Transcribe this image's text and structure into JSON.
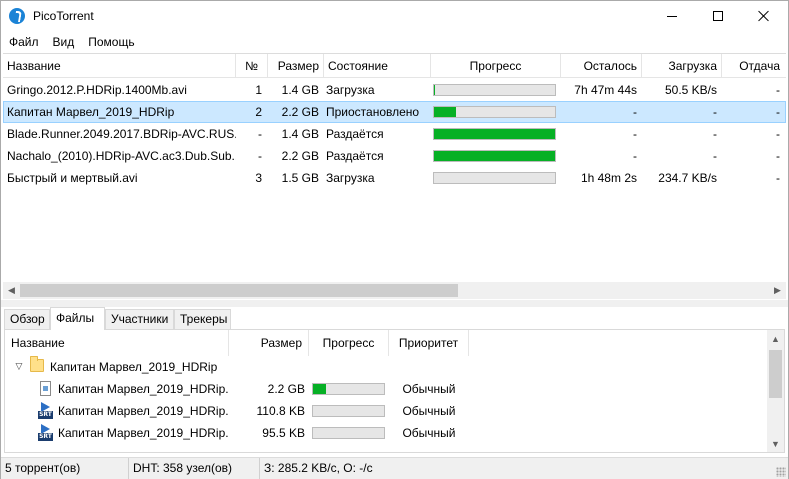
{
  "window": {
    "title": "PicoTorrent"
  },
  "menu": [
    "Файл",
    "Вид",
    "Помощь"
  ],
  "torrents": {
    "columns": [
      "Название",
      "№",
      "Размер",
      "Состояние",
      "Прогресс",
      "Осталось",
      "Загрузка",
      "Отдача"
    ],
    "rows": [
      {
        "name": "Gringo.2012.P.HDRip.1400Mb.avi",
        "num": "1",
        "size": "1.4 GB",
        "state": "Загрузка",
        "progress": 0.01,
        "remaining": "7h 47m 44s",
        "down": "50.5 KB/s",
        "up": "-"
      },
      {
        "name": "Капитан Марвел_2019_HDRip",
        "num": "2",
        "size": "2.2 GB",
        "state": "Приостановлено",
        "progress": 0.18,
        "remaining": "-",
        "down": "-",
        "up": "-"
      },
      {
        "name": "Blade.Runner.2049.2017.BDRip-AVC.RUS...",
        "num": "-",
        "size": "1.4 GB",
        "state": "Раздаётся",
        "progress": 1.0,
        "remaining": "-",
        "down": "-",
        "up": "-"
      },
      {
        "name": "Nachalo_(2010).HDRip-AVC.ac3.Dub.Sub...",
        "num": "-",
        "size": "2.2 GB",
        "state": "Раздаётся",
        "progress": 1.0,
        "remaining": "-",
        "down": "-",
        "up": "-"
      },
      {
        "name": "Быстрый и мертвый.avi",
        "num": "3",
        "size": "1.5 GB",
        "state": "Загрузка",
        "progress": 0.0,
        "remaining": "1h 48m 2s",
        "down": "234.7 KB/s",
        "up": "-"
      }
    ]
  },
  "tabs": [
    "Обзор",
    "Файлы",
    "Участники",
    "Трекеры"
  ],
  "files": {
    "columns": [
      "Название",
      "Размер",
      "Прогресс",
      "Приоритет"
    ],
    "folder": "Капитан Марвел_2019_HDRip",
    "rows": [
      {
        "name": "Капитан Марвел_2019_HDRip...",
        "size": "2.2 GB",
        "progress": 0.18,
        "priority": "Обычный",
        "icon": "video-file-icon"
      },
      {
        "name": "Капитан Марвел_2019_HDRip...",
        "size": "110.8 KB",
        "progress": 0.0,
        "priority": "Обычный",
        "icon": "srt-file-icon"
      },
      {
        "name": "Капитан Марвел_2019_HDRip...",
        "size": "95.5 KB",
        "progress": 0.0,
        "priority": "Обычный",
        "icon": "srt-file-icon"
      }
    ]
  },
  "status": {
    "torrents": "5 торрент(ов)",
    "dht": "DHT: 358 узел(ов)",
    "speed": "З: 285.2 KB/с, О: -/с"
  },
  "colors": {
    "progress_fill": "#06b025",
    "selection": "#cce8ff"
  }
}
